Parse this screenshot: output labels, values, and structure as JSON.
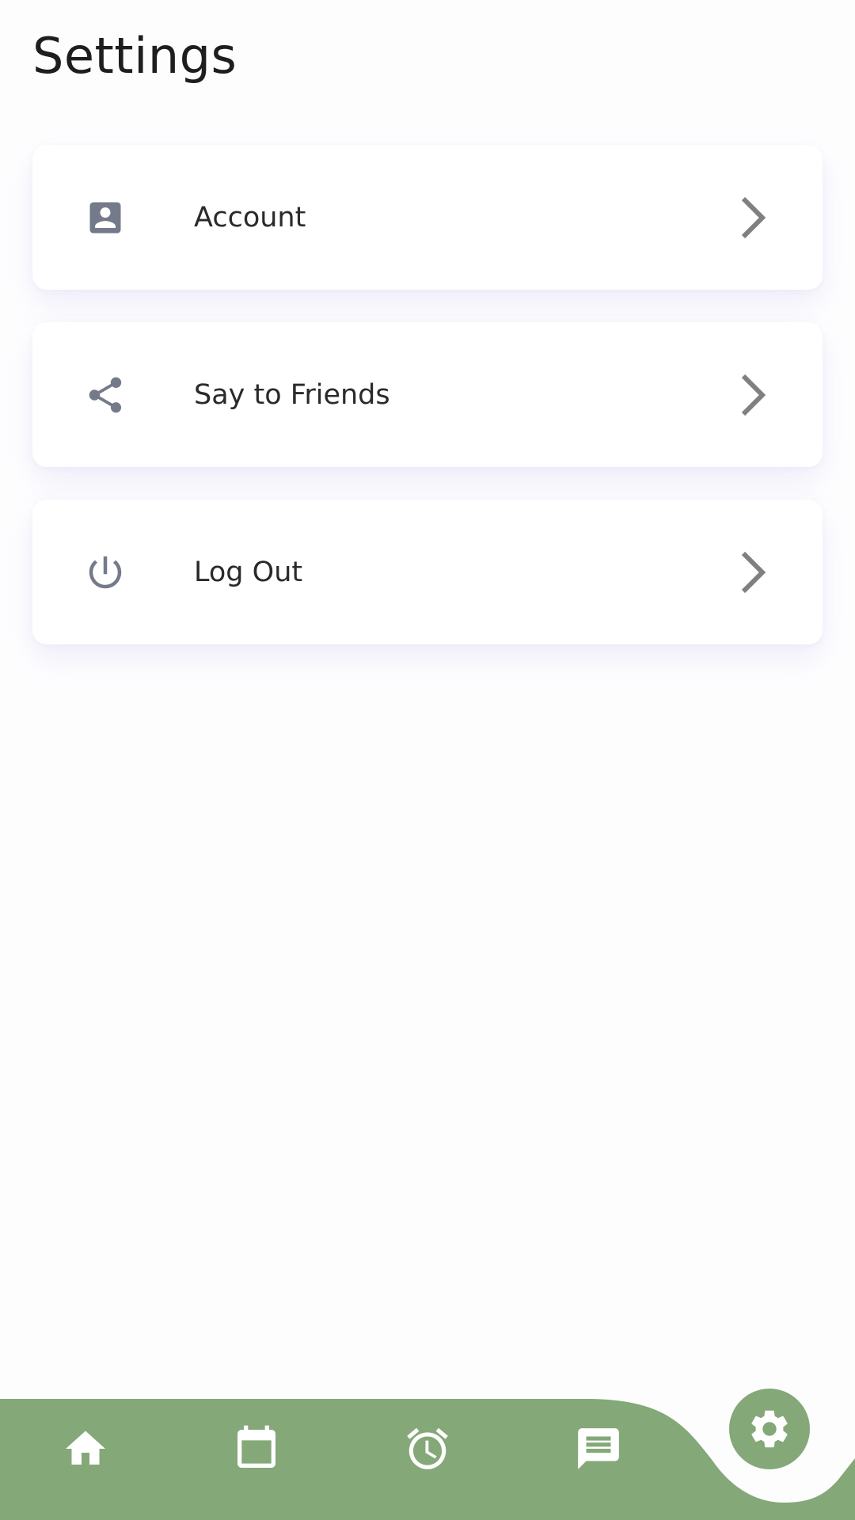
{
  "page": {
    "title": "Settings"
  },
  "settings": {
    "items": [
      {
        "label": "Account",
        "icon": "account-box-icon"
      },
      {
        "label": "Say to Friends",
        "icon": "share-icon"
      },
      {
        "label": "Log Out",
        "icon": "power-icon"
      }
    ]
  },
  "bottom_nav": {
    "items": [
      {
        "icon": "home-icon"
      },
      {
        "icon": "calendar-icon"
      },
      {
        "icon": "alarm-clock-icon"
      },
      {
        "icon": "message-icon"
      }
    ],
    "active_item": {
      "icon": "gear-icon"
    }
  },
  "colors": {
    "nav_background": "#84a878",
    "icon_gray": "#757a8b",
    "chevron_gray": "#808080",
    "text": "#2a2a2a"
  }
}
